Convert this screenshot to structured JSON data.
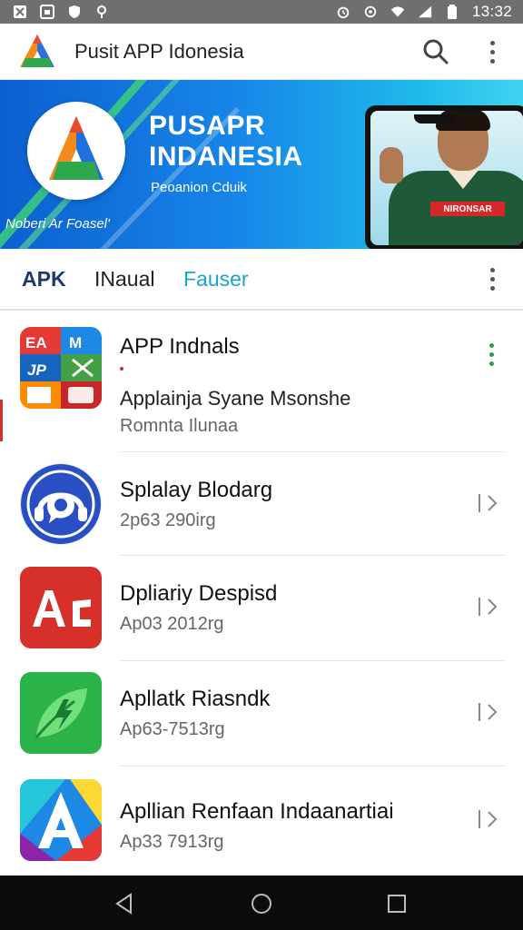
{
  "status_bar": {
    "time": "13:32"
  },
  "app_bar": {
    "title": "Pusit APP Idonesia"
  },
  "banner": {
    "title_line1": "PUSAPR",
    "title_line2": "INDANESIA",
    "subtitle": "Peoanion Cduik",
    "footer": "Noberi Ar Foasel'",
    "badge": "NIRONSAR"
  },
  "tabs": [
    {
      "label": "APK"
    },
    {
      "label": "INaual"
    },
    {
      "label": "Fauser"
    }
  ],
  "list": [
    {
      "title": "APP Indnals",
      "extra": "Applainja Syane Msonshe",
      "sub": "Romnta Ilunaa",
      "icon": "app-grid-icon"
    },
    {
      "title": "Splalay Blodarg",
      "sub": "2p63 290irg",
      "icon": "headset-chat-icon"
    },
    {
      "title": "Dpliariy Despisd",
      "sub": "Ap03 2012rg",
      "icon": "ac-letters-icon"
    },
    {
      "title": "Apllatk Riasndk",
      "sub": "Ap63-7513rg",
      "icon": "leaf-bolt-icon"
    },
    {
      "title": "Apllian Renfaan Indaanartiai",
      "sub": "Ap33 7913rg",
      "icon": "letter-a-icon"
    }
  ],
  "grid_icon_labels": {
    "tl": "EA",
    "tr": "M",
    "ml": "JP"
  },
  "colors": {
    "accent": "#1aa3cf",
    "primary_dark": "#1b3a6b",
    "green": "#2e9d4a",
    "red": "#d32f2f"
  }
}
